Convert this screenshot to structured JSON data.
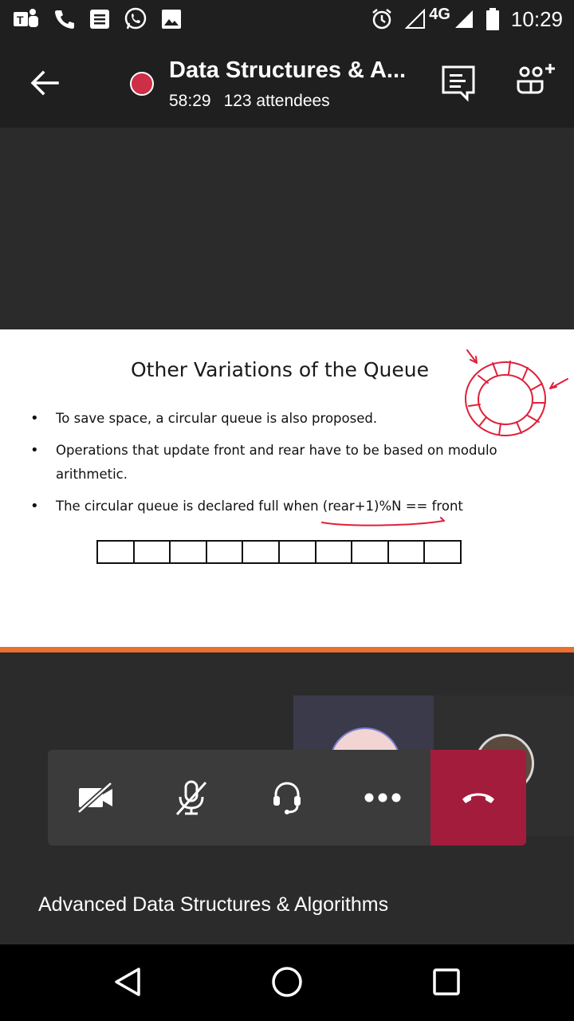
{
  "status_bar": {
    "network": "4G",
    "time": "10:29",
    "icons": [
      "teams-icon",
      "phone-icon",
      "message-icon",
      "whatsapp-icon",
      "gallery-icon",
      "alarm-icon",
      "signal-icon",
      "battery-icon"
    ]
  },
  "header": {
    "title": "Data Structures & A...",
    "duration": "58:29",
    "attendees": "123 attendees",
    "record_color": "#cc2f46"
  },
  "slide": {
    "title": "Other Variations of the Queue",
    "bullets": [
      "To save space, a circular queue is also proposed.",
      "Operations that update front and rear have to be based on modulo arithmetic.",
      "The circular queue is declared full when (rear+1)%N == front"
    ],
    "queue_cells": 10,
    "accent_bar_color": "#e9702f",
    "ink_color": "#e0203a"
  },
  "controls": {
    "icons": [
      "video-off-icon",
      "mic-off-icon",
      "headset-icon",
      "more-icon",
      "hang-up-icon"
    ],
    "hangup_color": "#a31c3c"
  },
  "footer": {
    "meeting_name": "Advanced Data Structures & Algorithms"
  },
  "nav": {
    "icons": [
      "back-triangle-icon",
      "home-circle-icon",
      "recents-square-icon"
    ]
  }
}
